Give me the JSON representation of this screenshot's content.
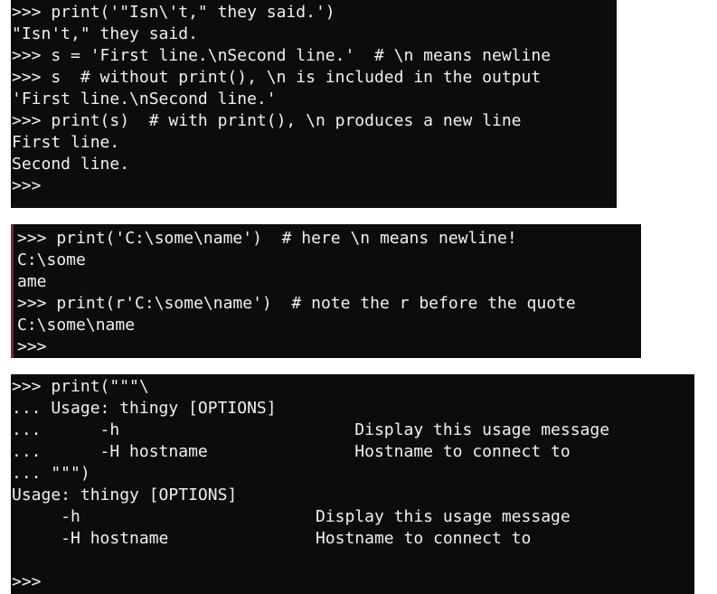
{
  "terminals": [
    {
      "lines": [
        ">>> print('\"Isn\\'t,\" they said.')",
        "\"Isn't,\" they said.",
        ">>> s = 'First line.\\nSecond line.'  # \\n means newline",
        ">>> s  # without print(), \\n is included in the output",
        "'First line.\\nSecond line.'",
        ">>> print(s)  # with print(), \\n produces a new line",
        "First line.",
        "Second line.",
        ">>>"
      ]
    },
    {
      "lines": [
        ">>> print('C:\\some\\name')  # here \\n means newline!",
        "C:\\some",
        "ame",
        ">>> print(r'C:\\some\\name')  # note the r before the quote",
        "C:\\some\\name",
        ">>>"
      ]
    },
    {
      "lines": [
        ">>> print(\"\"\"\\",
        "... Usage: thingy [OPTIONS]",
        "...      -h                        Display this usage message",
        "...      -H hostname               Hostname to connect to",
        "... \"\"\")",
        "Usage: thingy [OPTIONS]",
        "     -h                        Display this usage message",
        "     -H hostname               Hostname to connect to",
        "",
        ">>>"
      ]
    }
  ]
}
